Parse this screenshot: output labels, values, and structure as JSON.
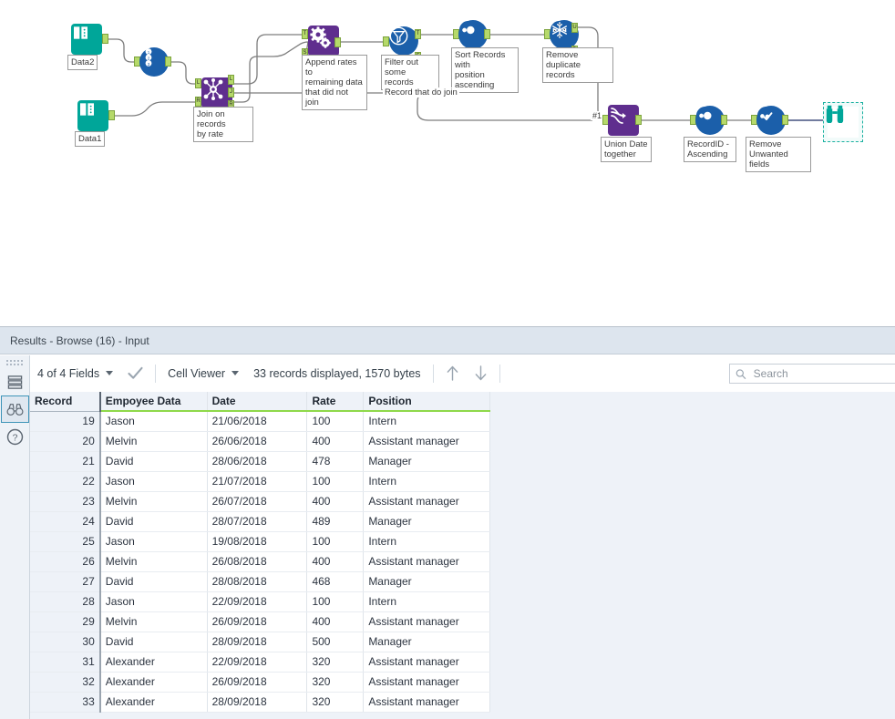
{
  "canvas": {
    "nodes": [
      {
        "id": "data2",
        "kind": "input",
        "label": "Data2"
      },
      {
        "id": "recordid1",
        "kind": "record-id",
        "label": ""
      },
      {
        "id": "join",
        "kind": "join",
        "label": "Join on records\nby rate"
      },
      {
        "id": "data1",
        "kind": "input",
        "label": "Data1"
      },
      {
        "id": "union1",
        "kind": "union",
        "label": "Append rates to\nremaining data\nthat did not join"
      },
      {
        "id": "filter",
        "kind": "filter",
        "label": "Filter out some\nrecords"
      },
      {
        "id": "sort1",
        "kind": "sort",
        "label": "Sort Records with\nposition\nascending"
      },
      {
        "id": "unique",
        "kind": "unique",
        "label": "Remove duplicate\nrecords"
      },
      {
        "id": "union2",
        "kind": "union",
        "label": "Union Date\ntogether"
      },
      {
        "id": "sort2",
        "kind": "sort",
        "label": "RecordID -\nAscending"
      },
      {
        "id": "select",
        "kind": "select",
        "label": "Remove\nUnwanted fields"
      },
      {
        "id": "browse",
        "kind": "browse",
        "label": ""
      }
    ],
    "connection_labels": [
      {
        "id": "join-label",
        "text": "Record that do join"
      },
      {
        "id": "union-input",
        "text": "#1"
      }
    ],
    "anchors": {
      "join_in_left": "L",
      "join_in_right": "R",
      "join_out_left": "L",
      "join_out_join": "J",
      "join_out_right": "R",
      "union_in_top": "T",
      "union_in_bottom": "S",
      "filter_out_true": "T",
      "filter_out_false": "F",
      "unique_out_unique": "U",
      "unique_out_dupe": "D"
    }
  },
  "results": {
    "title": "Results - Browse (16) - Input",
    "rail": [
      {
        "id": "table-icon",
        "name": "table-view"
      },
      {
        "id": "browse-icon",
        "name": "browse-view",
        "active": true
      },
      {
        "id": "help-icon",
        "name": "help"
      }
    ],
    "toolbar": {
      "fields_label": "4 of 4 Fields",
      "viewer_label": "Cell Viewer",
      "records_label": "33 records displayed, 1570 bytes",
      "up_arrow": "↑",
      "down_arrow": "↓"
    },
    "search": {
      "placeholder": "Search",
      "value": ""
    },
    "grid": {
      "columns": [
        "Record",
        "Empoyee Data",
        "Date",
        "Rate",
        "Position"
      ],
      "rows": [
        [
          "19",
          "Jason",
          "21/06/2018",
          "100",
          "Intern"
        ],
        [
          "20",
          "Melvin",
          "26/06/2018",
          "400",
          "Assistant manager"
        ],
        [
          "21",
          "David",
          "28/06/2018",
          "478",
          "Manager"
        ],
        [
          "22",
          "Jason",
          "21/07/2018",
          "100",
          "Intern"
        ],
        [
          "23",
          "Melvin",
          "26/07/2018",
          "400",
          "Assistant manager"
        ],
        [
          "24",
          "David",
          "28/07/2018",
          "489",
          "Manager"
        ],
        [
          "25",
          "Jason",
          "19/08/2018",
          "100",
          "Intern"
        ],
        [
          "26",
          "Melvin",
          "26/08/2018",
          "400",
          "Assistant manager"
        ],
        [
          "27",
          "David",
          "28/08/2018",
          "468",
          "Manager"
        ],
        [
          "28",
          "Jason",
          "22/09/2018",
          "100",
          "Intern"
        ],
        [
          "29",
          "Melvin",
          "26/09/2018",
          "400",
          "Assistant manager"
        ],
        [
          "30",
          "David",
          "28/09/2018",
          "500",
          "Manager"
        ],
        [
          "31",
          "Alexander",
          "22/09/2018",
          "320",
          "Assistant manager"
        ],
        [
          "32",
          "Alexander",
          "26/09/2018",
          "320",
          "Assistant manager"
        ],
        [
          "33",
          "Alexander",
          "28/09/2018",
          "320",
          "Assistant manager"
        ]
      ]
    }
  },
  "colors": {
    "teal": "#00a699",
    "purple": "#5f2e8e",
    "blue": "#1b5faa",
    "anchor_green": "#b5d96a",
    "header_underline": "#8fd94a",
    "panel_title_bg": "#dde5ee"
  }
}
